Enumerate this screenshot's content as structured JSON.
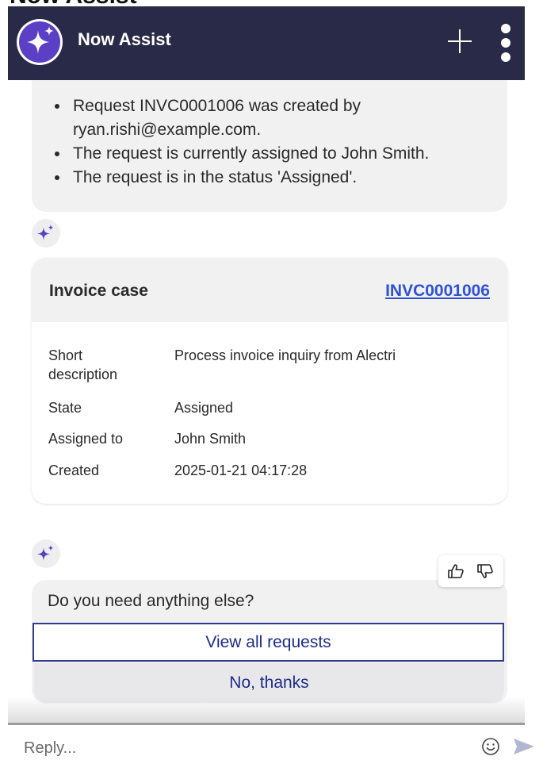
{
  "app": {
    "title_cut": "Now Assist",
    "header_title": "Now Assist"
  },
  "summary": {
    "items": [
      "Request INVC0001006 was created by ryan.rishi@example.com.",
      "The request is currently assigned to John Smith.",
      "The request is in the status 'Assigned'."
    ]
  },
  "card": {
    "title": "Invoice case",
    "record_link": "INVC0001006",
    "fields": [
      {
        "label": "Short description",
        "value": "Process invoice inquiry from Alectri"
      },
      {
        "label": "State",
        "value": "Assigned"
      },
      {
        "label": "Assigned to",
        "value": "John Smith"
      },
      {
        "label": "Created",
        "value": "2025-01-21 04:17:28"
      }
    ]
  },
  "followup": {
    "question": "Do you need anything else?",
    "options": [
      "View all requests",
      "No, thanks"
    ]
  },
  "composer": {
    "placeholder": "Reply..."
  },
  "icons": {
    "logo": "sparkle-logo-icon",
    "ai_badge": "sparkle-icon",
    "add": "plus-icon",
    "menu": "kebab-menu-icon",
    "thumbs_up": "thumbs-up-icon",
    "thumbs_down": "thumbs-down-icon",
    "emoji": "smiley-icon",
    "send": "send-icon"
  },
  "colors": {
    "header_bg": "#282a47",
    "accent": "#5b3fc4",
    "link": "#2f52d6",
    "button_text": "#1e2c8a",
    "bubble_bg": "#f1f1f2"
  }
}
